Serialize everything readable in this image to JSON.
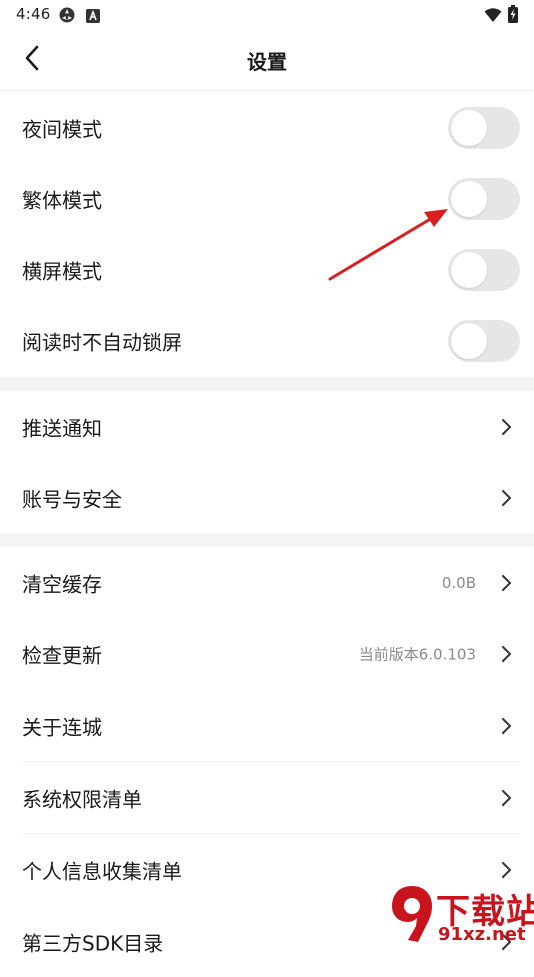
{
  "status_bar": {
    "time": "4:46",
    "icons": [
      "sync-icon",
      "a-badge-icon",
      "wifi-icon",
      "battery-charging-icon"
    ]
  },
  "header": {
    "title": "设置",
    "back_icon": "chevron-left-icon"
  },
  "sections": {
    "display": [
      {
        "label": "夜间模式",
        "control": "toggle",
        "on": false
      },
      {
        "label": "繁体模式",
        "control": "toggle",
        "on": false
      },
      {
        "label": "横屏模式",
        "control": "toggle",
        "on": false
      },
      {
        "label": "阅读时不自动锁屏",
        "control": "toggle",
        "on": false
      }
    ],
    "account": [
      {
        "label": "推送通知",
        "control": "chevron"
      },
      {
        "label": "账号与安全",
        "control": "chevron"
      }
    ],
    "general": [
      {
        "label": "清空缓存",
        "value": "0.0B",
        "control": "chevron"
      },
      {
        "label": "检查更新",
        "value": "当前版本6.0.103",
        "control": "chevron"
      },
      {
        "label": "关于连城",
        "control": "chevron"
      },
      {
        "label": "系统权限清单",
        "control": "chevron"
      },
      {
        "label": "个人信息收集清单",
        "control": "chevron"
      },
      {
        "label": "第三方SDK目录",
        "control": "chevron"
      }
    ]
  },
  "annotation": {
    "type": "arrow",
    "color": "#d9201f",
    "points_to": "繁体模式 toggle"
  },
  "watermark": {
    "title": "下载站",
    "site": "91xz.net",
    "color": "#c8151d"
  },
  "colors": {
    "toggle_off": "#e6e6e6",
    "section_gap": "#f5f5f5",
    "secondary_text": "#8a8a8a"
  }
}
